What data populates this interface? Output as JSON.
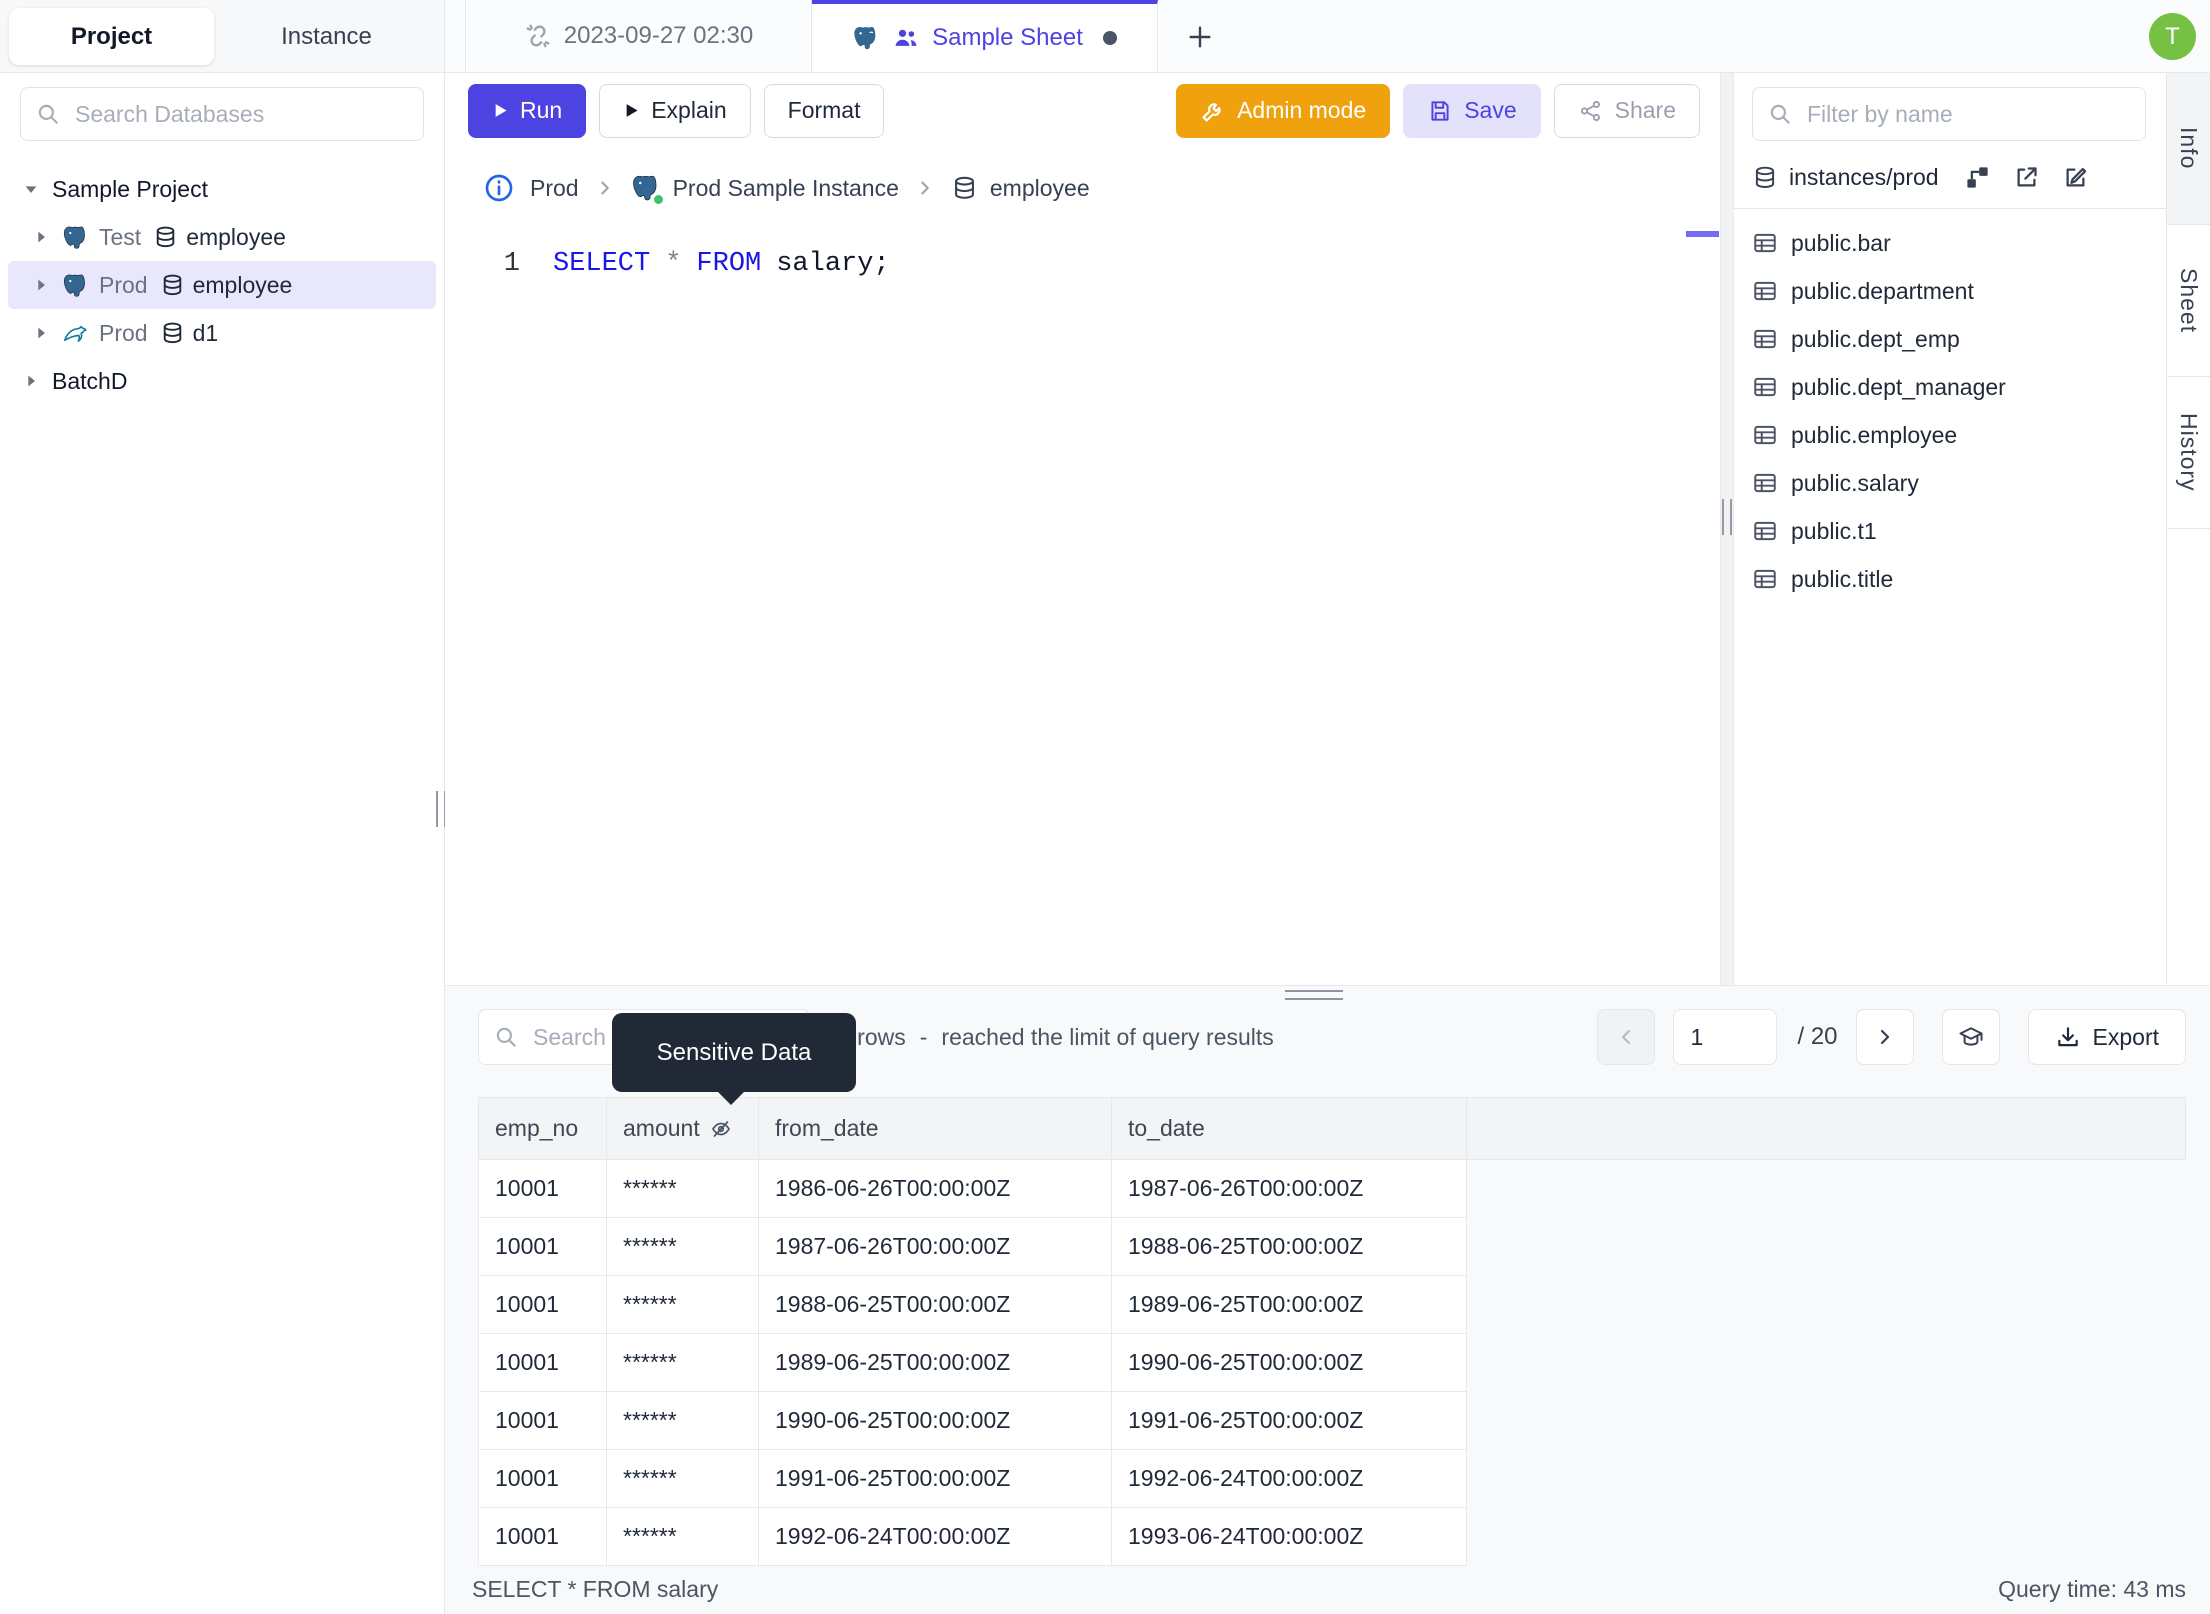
{
  "colors": {
    "accent": "#4d43e0",
    "admin_orange": "#f0a20e",
    "avatar_green": "#76c043",
    "keyword_blue": "#1a16e8",
    "selected_row_bg": "#e9e7fc",
    "tooltip_bg": "#212936"
  },
  "sidebar": {
    "tab_project": "Project",
    "tab_instance": "Instance",
    "search_placeholder": "Search Databases",
    "project1": "Sample Project",
    "node1": {
      "env": "Test",
      "db": "employee",
      "engine": "postgres"
    },
    "node2": {
      "env": "Prod",
      "db": "employee",
      "engine": "postgres"
    },
    "node3": {
      "env": "Prod",
      "db": "d1",
      "engine": "mysql"
    },
    "project2": "BatchD"
  },
  "tab_bar": {
    "tab1": "2023-09-27 02:30",
    "tab2": "Sample Sheet"
  },
  "user": {
    "initial": "T"
  },
  "toolbar": {
    "run": "Run",
    "explain": "Explain",
    "format": "Format",
    "admin_mode": "Admin mode",
    "save": "Save",
    "share": "Share"
  },
  "breadcrumb": {
    "env": "Prod",
    "instance": "Prod Sample Instance",
    "database": "employee"
  },
  "editor": {
    "line_no": "1",
    "kw_select": "SELECT",
    "star": "*",
    "kw_from": "FROM",
    "rest": "salary;"
  },
  "right_panel": {
    "filter_placeholder": "Filter by name",
    "connection": "instances/prod",
    "tables": [
      "public.bar",
      "public.department",
      "public.dept_emp",
      "public.dept_manager",
      "public.employee",
      "public.salary",
      "public.t1",
      "public.title"
    ],
    "side_tabs": {
      "info": "Info",
      "sheet": "Sheet",
      "history": "History"
    }
  },
  "results": {
    "search_placeholder": "Search",
    "tooltip": "Sensitive Data",
    "rows_count": "0 rows",
    "dash": "-",
    "limit_note": "reached the limit of query results",
    "page_value": "1",
    "page_total": "/ 20",
    "export_label": "Export",
    "table": {
      "columns": [
        "emp_no",
        "amount",
        "from_date",
        "to_date"
      ],
      "rows": [
        [
          "10001",
          "******",
          "1986-06-26T00:00:00Z",
          "1987-06-26T00:00:00Z"
        ],
        [
          "10001",
          "******",
          "1987-06-26T00:00:00Z",
          "1988-06-25T00:00:00Z"
        ],
        [
          "10001",
          "******",
          "1988-06-25T00:00:00Z",
          "1989-06-25T00:00:00Z"
        ],
        [
          "10001",
          "******",
          "1989-06-25T00:00:00Z",
          "1990-06-25T00:00:00Z"
        ],
        [
          "10001",
          "******",
          "1990-06-25T00:00:00Z",
          "1991-06-25T00:00:00Z"
        ],
        [
          "10001",
          "******",
          "1991-06-25T00:00:00Z",
          "1992-06-24T00:00:00Z"
        ],
        [
          "10001",
          "******",
          "1992-06-24T00:00:00Z",
          "1993-06-24T00:00:00Z"
        ]
      ]
    },
    "footer": {
      "query": "SELECT * FROM salary",
      "time": "Query time: 43 ms"
    }
  }
}
